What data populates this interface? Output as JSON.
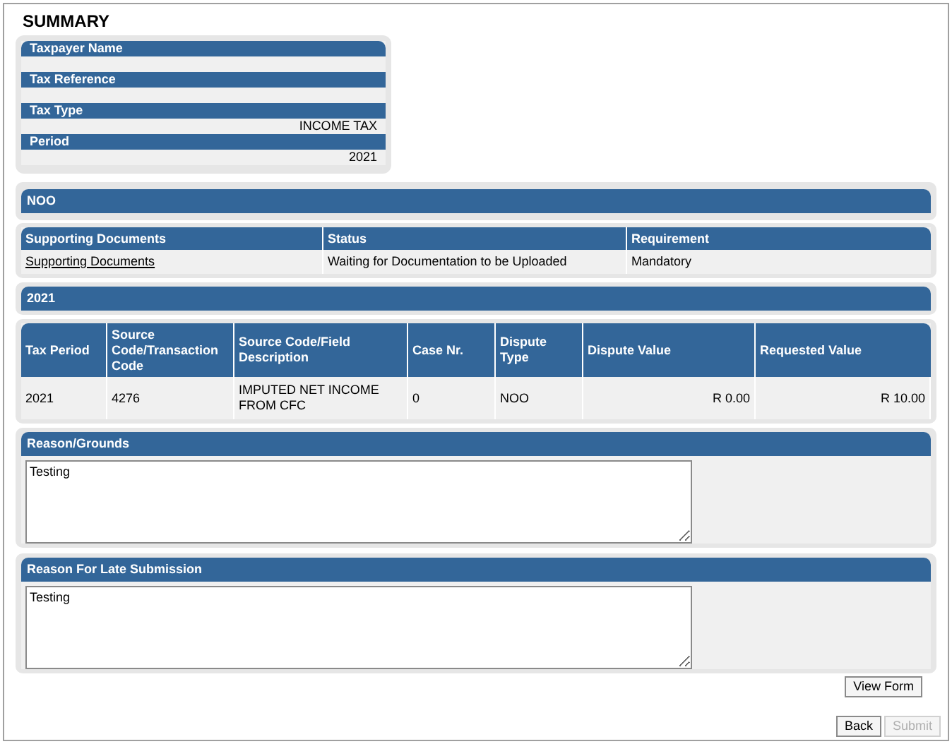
{
  "title": "SUMMARY",
  "summary_fields": [
    {
      "label": "Taxpayer Name"
    },
    {
      "label": "Tax Reference"
    },
    {
      "label": "Tax Type",
      "value": "INCOME TAX"
    },
    {
      "label": "Period",
      "value": "2021"
    }
  ],
  "case_type": "NOO",
  "documents_table": {
    "columns": [
      "Supporting Documents",
      "Status",
      "Requirement"
    ],
    "rows": [
      {
        "document": "Supporting Documents",
        "status": "Waiting for Documentation to be Uploaded",
        "requirement": "Mandatory"
      }
    ]
  },
  "period_heading": "2021",
  "dispute_table": {
    "columns": [
      "Tax Period",
      "Source Code/Transaction Code",
      "Source Code/Field Description",
      "Case Nr.",
      "Dispute Type",
      "Dispute Value",
      "Requested Value"
    ],
    "rows": [
      [
        "2021",
        "4276",
        "IMPUTED NET INCOME FROM CFC",
        "0",
        "NOO",
        "R 0.00",
        "R 10.00"
      ]
    ]
  },
  "reason_grounds": {
    "label": "Reason/Grounds",
    "value": "Testing"
  },
  "late_submission": {
    "label": "Reason For Late Submission",
    "value": "Testing"
  },
  "view_form_button": {
    "label": "View Form",
    "disabled": false
  },
  "buttons": [
    {
      "label": "Back",
      "disabled": false
    },
    {
      "label": "Submit",
      "disabled": true
    }
  ]
}
